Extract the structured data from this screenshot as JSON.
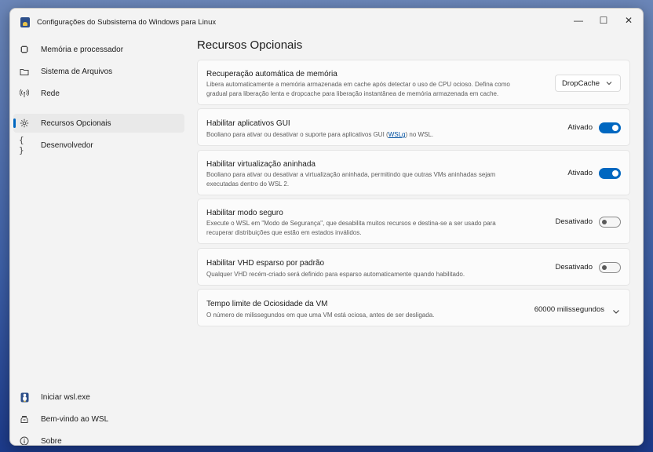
{
  "window": {
    "title": "Configurações do Subsistema do Windows para Linux",
    "minimize_glyph": "—",
    "maximize_glyph": "☐",
    "close_glyph": "✕"
  },
  "sidebar": {
    "items": [
      {
        "label": "Memória e processador",
        "icon": "memory-chip-icon"
      },
      {
        "label": "Sistema de Arquivos",
        "icon": "folder-icon"
      },
      {
        "label": "Rede",
        "icon": "network-icon"
      },
      {
        "label": "Recursos Opcionais",
        "icon": "gear-icon",
        "active": true
      },
      {
        "label": "Desenvolvedor",
        "icon": "code-braces-icon"
      }
    ],
    "footer": [
      {
        "label": "Iniciar wsl.exe",
        "icon": "penguin-icon"
      },
      {
        "label": "Bem-vindo ao WSL",
        "icon": "welcome-icon"
      },
      {
        "label": "Sobre",
        "icon": "info-icon"
      }
    ]
  },
  "main": {
    "title": "Recursos Opcionais",
    "settings": [
      {
        "title": "Recuperação automática de memória",
        "desc_line1": "Libera automaticamente a memória armazenada em cache após detectar o uso de CPU ocioso. Defina como",
        "desc_line2": "gradual para liberação lenta e dropcache para liberação instantânea de memória armazenada em cache.",
        "control": "dropdown",
        "value": "DropCache"
      },
      {
        "title": "Habilitar aplicativos GUI",
        "desc_pre": "Booliano para ativar ou desativar o suporte para aplicativos GUI (",
        "desc_link": "WSLg",
        "desc_post": ") no WSL.",
        "control": "toggle",
        "state_label": "Ativado",
        "on": true
      },
      {
        "title": "Habilitar virtualização aninhada",
        "desc_line1": "Booliano para ativar ou desativar a virtualização aninhada, permitindo que outras VMs aninhadas sejam",
        "desc_line2": "executadas dentro do WSL 2.",
        "control": "toggle",
        "state_label": "Ativado",
        "on": true
      },
      {
        "title": "Habilitar modo seguro",
        "desc_line1": "Execute o WSL em \"Modo de Segurança\", que desabilita muitos recursos e destina-se a ser usado para",
        "desc_line2": "recuperar distribuições que estão em estados inválidos.",
        "control": "toggle",
        "state_label": "Desativado",
        "on": false
      },
      {
        "title": "Habilitar VHD esparso por padrão",
        "desc_line1": "Qualquer VHD recém-criado será definido para esparso automaticamente quando habilitado.",
        "control": "toggle",
        "state_label": "Desativado",
        "on": false
      },
      {
        "title": "Tempo limite de Ociosidade da VM",
        "desc_line1": "O número de milissegundos em que uma VM está ociosa, antes de ser desligada.",
        "control": "expander",
        "value": "60000 milissegundos"
      }
    ]
  },
  "colors": {
    "accent": "#0067c0",
    "window_bg": "#f3f3f3",
    "card_bg": "#fbfbfb"
  }
}
